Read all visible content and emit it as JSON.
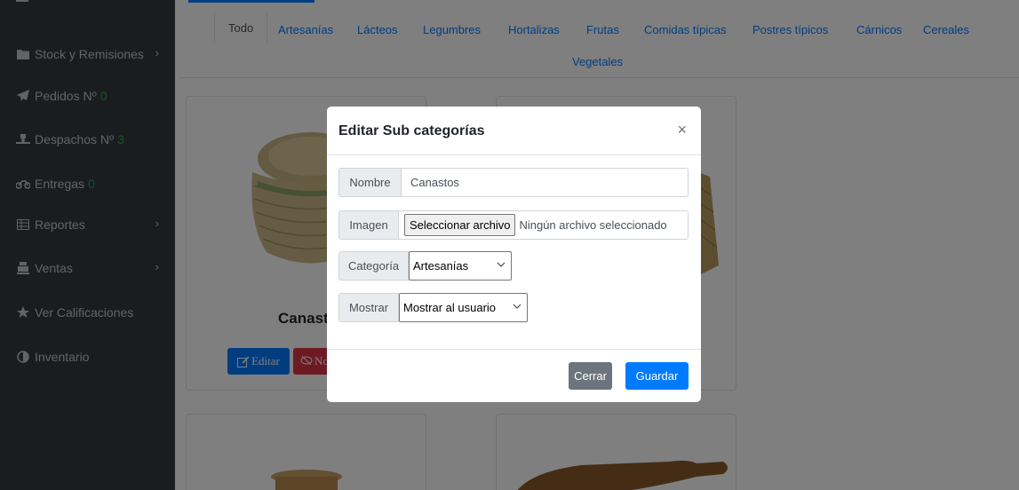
{
  "sidebar": {
    "items": [
      {
        "label": "Stock y Remisiones",
        "icon": "folder-icon",
        "count": "",
        "has_chevron": true
      },
      {
        "label": "Pedidos Nº",
        "icon": "paper-plane-icon",
        "count": "0",
        "has_chevron": false
      },
      {
        "label": "Despachos Nº",
        "icon": "truck-loading-icon",
        "count": "3",
        "has_chevron": false
      },
      {
        "label": "Entregas",
        "icon": "motorcycle-icon",
        "count": "0",
        "has_chevron": false
      },
      {
        "label": "Reportes",
        "icon": "table-icon",
        "count": "",
        "has_chevron": true
      },
      {
        "label": "Ventas",
        "icon": "cash-register-icon",
        "count": "",
        "has_chevron": true
      },
      {
        "label": "Ver Calificaciones",
        "icon": "star-icon",
        "count": "",
        "has_chevron": false
      },
      {
        "label": "Inventario",
        "icon": "adjust-icon",
        "count": "",
        "has_chevron": false
      }
    ],
    "chevron_glyph": "›"
  },
  "tabs": [
    "Todo",
    "Artesanías",
    "Lácteos",
    "Legumbres",
    "Hortalizas",
    "Frutas",
    "Comidas típicas",
    "Postres típicos",
    "Cárnicos",
    "Cereales",
    "Vegetales"
  ],
  "product_card": {
    "title": "Canastos",
    "edit_label": "Editar",
    "hide_label": "No"
  },
  "modal": {
    "title": "Editar Sub categorías",
    "close_glyph": "×",
    "nombre_label": "Nombre",
    "nombre_value": "Canastos",
    "imagen_label": "Imagen",
    "file_button": "Seleccionar archivo",
    "file_status": "Ningún archivo seleccionado",
    "categoria_label": "Categoría",
    "categoria_value": "Artesanías",
    "mostrar_label": "Mostrar",
    "mostrar_value": "Mostrar al usuario",
    "cancel_label": "Cerrar",
    "save_label": "Guardar"
  },
  "colors": {
    "sidebar_bg": "#343a40",
    "primary": "#007bff",
    "danger": "#dc3545",
    "secondary": "#6c757d",
    "count_green": "#28a745"
  }
}
